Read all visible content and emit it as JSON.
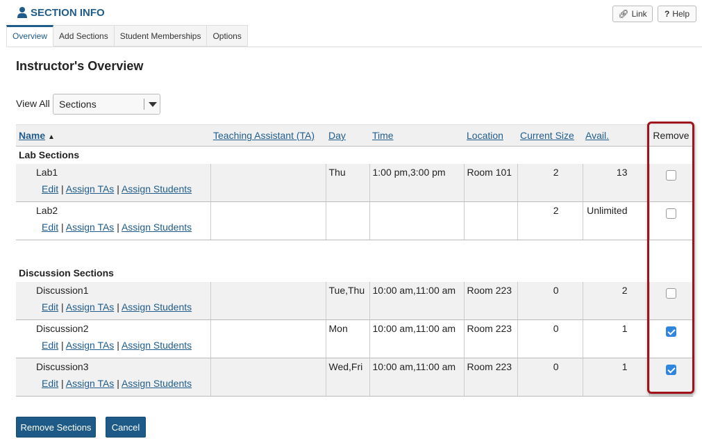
{
  "header": {
    "title": "SECTION INFO",
    "icon": "user-icon",
    "link_label": "Link",
    "help_label": "Help"
  },
  "tabs": [
    {
      "label": "Overview",
      "active": true
    },
    {
      "label": "Add Sections",
      "active": false
    },
    {
      "label": "Student Memberships",
      "active": false
    },
    {
      "label": "Options",
      "active": false
    }
  ],
  "page_title": "Instructor's Overview",
  "view_all": {
    "label": "View All",
    "selected": "Sections"
  },
  "table": {
    "columns": {
      "name": "Name",
      "ta": "Teaching Assistant (TA)",
      "day": "Day",
      "time": "Time",
      "location": "Location",
      "size": "Current Size",
      "avail": "Avail.",
      "remove": "Remove"
    },
    "row_actions": {
      "edit": "Edit",
      "assign_tas": "Assign TAs",
      "assign_students": "Assign Students",
      "separator": "|"
    },
    "categories": [
      {
        "title": "Lab Sections",
        "sections": [
          {
            "name": "Lab1",
            "ta": "",
            "day": "Thu",
            "time": "1:00 pm,3:00 pm",
            "location": "Room 101",
            "size": "2",
            "avail": "13",
            "remove": false
          },
          {
            "name": "Lab2",
            "ta": "",
            "day": "",
            "time": "",
            "location": "",
            "size": "2",
            "avail": "Unlimited",
            "remove": false
          }
        ]
      },
      {
        "title": "Discussion Sections",
        "sections": [
          {
            "name": "Discussion1",
            "ta": "",
            "day": "Tue,Thu",
            "time": "10:00 am,11:00 am",
            "location": "Room 223",
            "size": "0",
            "avail": "2",
            "remove": false
          },
          {
            "name": "Discussion2",
            "ta": "",
            "day": "Mon",
            "time": "10:00 am,11:00 am",
            "location": "Room 223",
            "size": "0",
            "avail": "1",
            "remove": true
          },
          {
            "name": "Discussion3",
            "ta": "",
            "day": "Wed,Fri",
            "time": "10:00 am,11:00 am",
            "location": "Room 223",
            "size": "0",
            "avail": "1",
            "remove": true
          }
        ]
      }
    ]
  },
  "buttons": {
    "remove": "Remove Sections",
    "cancel": "Cancel"
  },
  "colors": {
    "accent": "#1f5c8b",
    "primary_button": "#1d5a87",
    "highlight": "#a0131a",
    "checkbox_on": "#2e86de"
  }
}
